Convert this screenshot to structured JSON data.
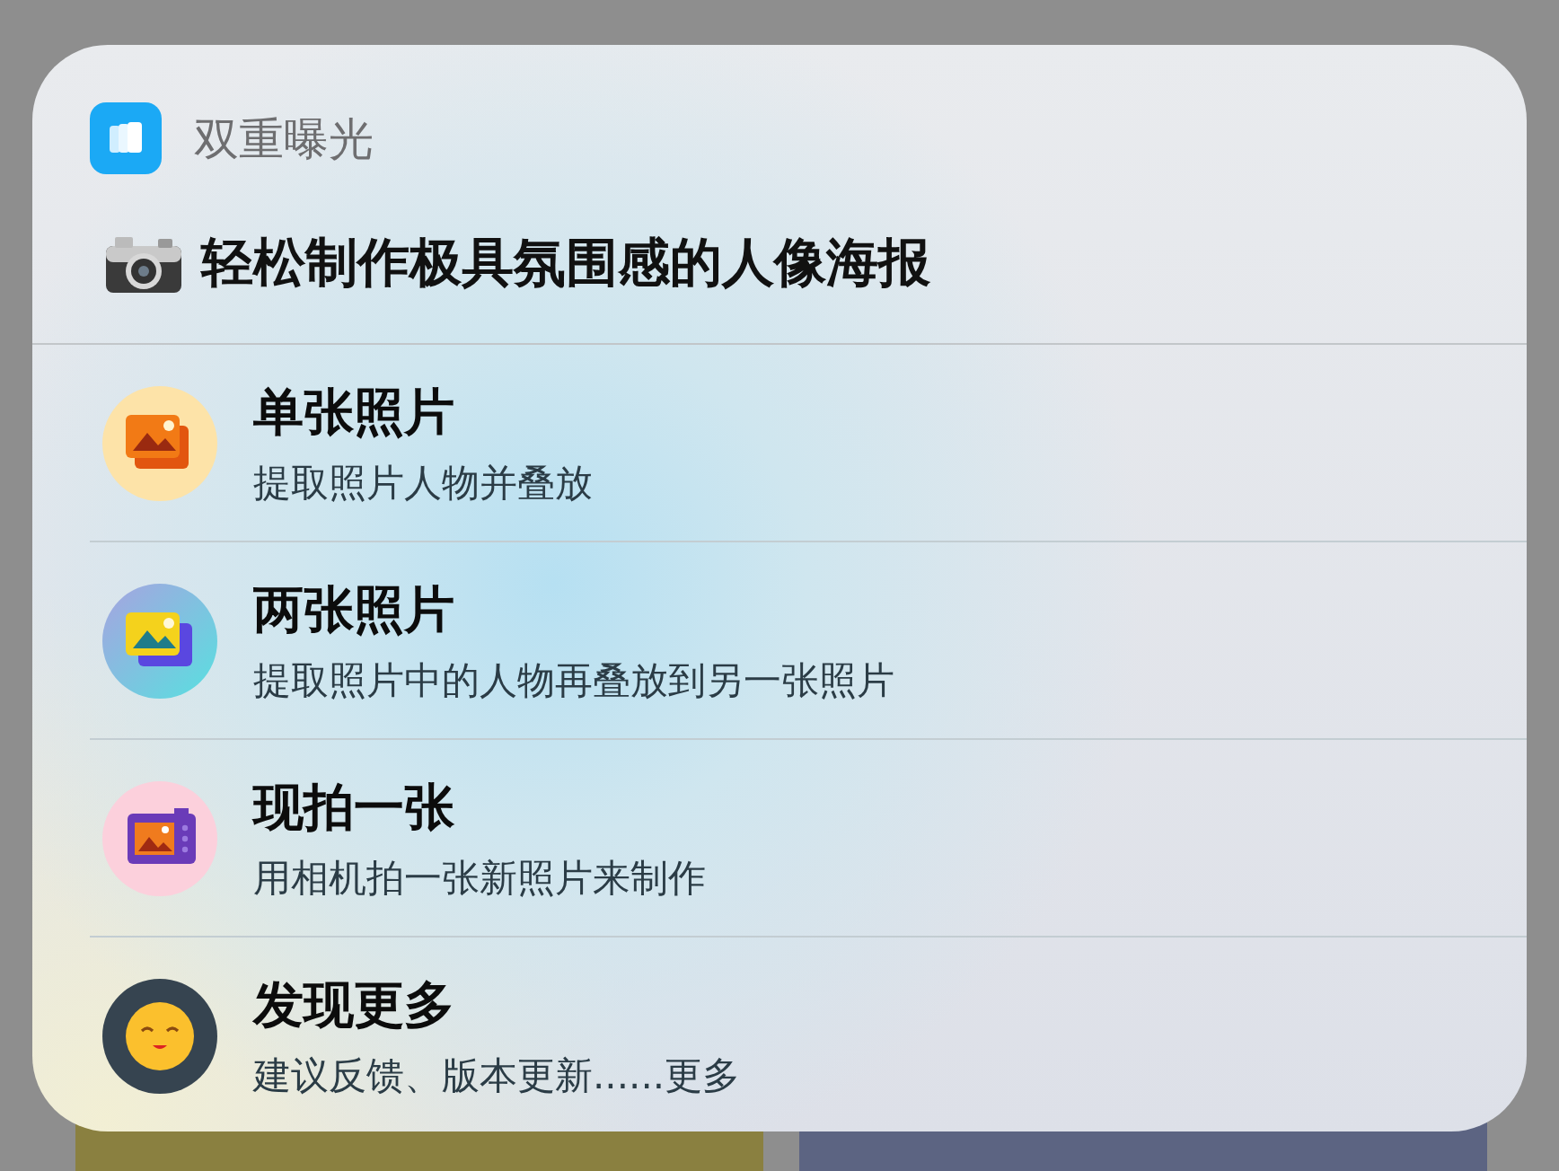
{
  "app": {
    "title": "双重曝光"
  },
  "headline": "轻松制作极具氛围感的人像海报",
  "items": [
    {
      "kind": "photo",
      "title": "单张照片",
      "subtitle": "提取照片人物并叠放"
    },
    {
      "kind": "photos",
      "title": "两张照片",
      "subtitle": "提取照片中的人物再叠放到另一张照片"
    },
    {
      "kind": "camera",
      "title": "现拍一张",
      "subtitle": "用相机拍一张新照片来制作"
    },
    {
      "kind": "smile",
      "title": "发现更多",
      "subtitle": "建议反馈、版本更新......更多"
    }
  ]
}
